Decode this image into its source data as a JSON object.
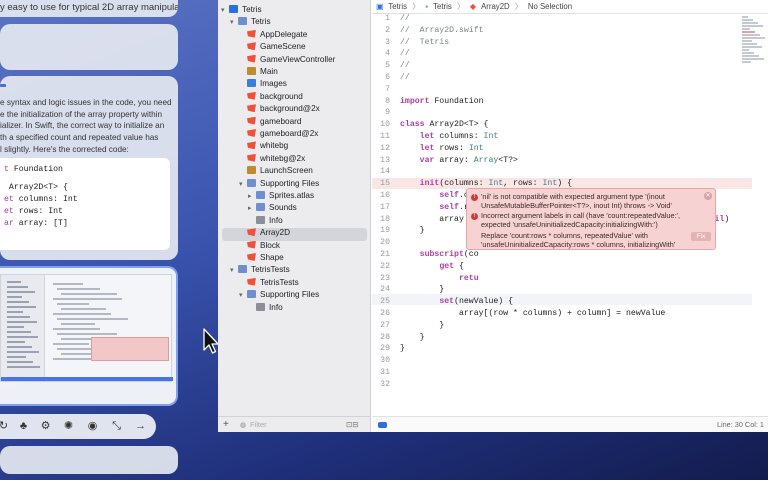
{
  "chat": {
    "top_text": "y easy to use for typical 2D array manipulations.",
    "answer_lines": [
      "e syntax and logic issues in the code, you need",
      "e the initialization of the array property within",
      "ializer. In Swift, the correct way to initialize an",
      "th a specified count and repeated value has",
      "l slightly. Here's the corrected code:"
    ],
    "code_lines": [
      {
        "kw": "t",
        "rest": " Foundation"
      },
      {
        "kw": "",
        "rest": " Array2D<T> {"
      },
      {
        "kw": "et",
        "rest": " columns: Int"
      },
      {
        "kw": "et",
        "rest": " rows: Int"
      },
      {
        "kw": "ar",
        "rest": " array: [T]"
      }
    ],
    "toolbar_icons": [
      "replay-icon",
      "users-icon",
      "gear-icon",
      "sparkle-icon",
      "stop-icon",
      "resize-icon",
      "send-arrow-icon"
    ]
  },
  "xcode": {
    "jumpbar": [
      "Tetris",
      "Tetris",
      "Array2D",
      "No Selection"
    ],
    "navigator": [
      {
        "label": "Tetris",
        "icon": "proj",
        "indent": 0,
        "chev": "▾"
      },
      {
        "label": "Tetris",
        "icon": "folder",
        "indent": 1,
        "chev": "▾"
      },
      {
        "label": "AppDelegate",
        "icon": "swift",
        "indent": 2,
        "chev": ""
      },
      {
        "label": "GameScene",
        "icon": "swift",
        "indent": 2,
        "chev": ""
      },
      {
        "label": "GameViewController",
        "icon": "swift",
        "indent": 2,
        "chev": ""
      },
      {
        "label": "Main",
        "icon": "story",
        "indent": 2,
        "chev": ""
      },
      {
        "label": "Images",
        "icon": "asset",
        "indent": 2,
        "chev": ""
      },
      {
        "label": "background",
        "icon": "swift",
        "indent": 2,
        "chev": ""
      },
      {
        "label": "background@2x",
        "icon": "swift",
        "indent": 2,
        "chev": ""
      },
      {
        "label": "gameboard",
        "icon": "swift",
        "indent": 2,
        "chev": ""
      },
      {
        "label": "gameboard@2x",
        "icon": "swift",
        "indent": 2,
        "chev": ""
      },
      {
        "label": "whitebg",
        "icon": "swift",
        "indent": 2,
        "chev": ""
      },
      {
        "label": "whitebg@2x",
        "icon": "swift",
        "indent": 2,
        "chev": ""
      },
      {
        "label": "LaunchScreen",
        "icon": "story",
        "indent": 2,
        "chev": ""
      },
      {
        "label": "Supporting Files",
        "icon": "folder",
        "indent": 2,
        "chev": "▾"
      },
      {
        "label": "Sprites.atlas",
        "icon": "folder",
        "indent": 3,
        "chev": "▸"
      },
      {
        "label": "Sounds",
        "icon": "folder",
        "indent": 3,
        "chev": "▸"
      },
      {
        "label": "Info",
        "icon": "plist",
        "indent": 3,
        "chev": ""
      },
      {
        "label": "Array2D",
        "icon": "swift",
        "indent": 2,
        "chev": ""
      },
      {
        "label": "Block",
        "icon": "swift",
        "indent": 2,
        "chev": ""
      },
      {
        "label": "Shape",
        "icon": "swift",
        "indent": 2,
        "chev": ""
      },
      {
        "label": "TetrisTests",
        "icon": "folder",
        "indent": 1,
        "chev": "▾"
      },
      {
        "label": "TetrisTests",
        "icon": "swift",
        "indent": 2,
        "chev": ""
      },
      {
        "label": "Supporting Files",
        "icon": "folder",
        "indent": 2,
        "chev": "▾"
      },
      {
        "label": "Info",
        "icon": "plist",
        "indent": 3,
        "chev": ""
      }
    ],
    "filter_placeholder": "Filter",
    "code": [
      {
        "n": "1",
        "html": "<span class='cm'>//</span>"
      },
      {
        "n": "2",
        "html": "<span class='cm'>//  Array2D.swift</span>"
      },
      {
        "n": "3",
        "html": "<span class='cm'>//  Tetris</span>"
      },
      {
        "n": "4",
        "html": "<span class='cm'>//</span>"
      },
      {
        "n": "5",
        "html": "<span class='cm'>//</span>"
      },
      {
        "n": "6",
        "html": "<span class='cm'>//</span>"
      },
      {
        "n": "7",
        "html": ""
      },
      {
        "n": "8",
        "html": "<span class='k2'>import</span> Foundation"
      },
      {
        "n": "9",
        "html": ""
      },
      {
        "n": "10",
        "html": "<span class='k2'>class</span> Array2D&lt;T&gt; {"
      },
      {
        "n": "11",
        "html": "    <span class='k2'>let</span> columns: <span class='t2'>Int</span>"
      },
      {
        "n": "12",
        "html": "    <span class='k2'>let</span> rows: <span class='t2'>Int</span>"
      },
      {
        "n": "13",
        "html": "    <span class='k2'>var</span> array: <span class='t2'>Array</span>&lt;T?&gt;"
      },
      {
        "n": "14",
        "html": ""
      },
      {
        "n": "15",
        "html": "    <span class='k2'>init</span>(columns: <span class='t2'>Int</span>, rows: <span class='t2'>Int</span>) {"
      },
      {
        "n": "16",
        "html": "        <span class='k2'>self</span>.columns = columns"
      },
      {
        "n": "17",
        "html": "        <span class='k2'>self</span>.rows = rows"
      },
      {
        "n": "18",
        "html": "        array = <span class='t2'>Array</span>&lt;T?&gt;(count:rows * columns, repeatedValue: <span class='k2'>nil</span>)"
      },
      {
        "n": "19",
        "html": "    }"
      },
      {
        "n": "20",
        "html": ""
      },
      {
        "n": "21",
        "html": "    <span class='k2'>subscript</span>(co"
      },
      {
        "n": "22",
        "html": "        <span class='k2'>get</span> {"
      },
      {
        "n": "23",
        "html": "            <span class='k2'>retu</span>"
      },
      {
        "n": "24",
        "html": "        }"
      },
      {
        "n": "25",
        "html": "        <span class='k2'>set</span>(newValue) {"
      },
      {
        "n": "26",
        "html": "            array[(row * columns) + column] = newValue"
      },
      {
        "n": "27",
        "html": "        }"
      },
      {
        "n": "28",
        "html": "    }"
      },
      {
        "n": "29",
        "html": "}"
      },
      {
        "n": "30",
        "html": ""
      },
      {
        "n": "31",
        "html": ""
      },
      {
        "n": "32",
        "html": ""
      }
    ],
    "errors": [
      "'nil' is not compatible with expected argument type '(inout UnsafeMutableBufferPointer<T?>, inout Int) throws -> Void'",
      "Incorrect argument labels in call (have 'count:repeatedValue:', expected 'unsafeUninitializedCapacity:initializingWith:')",
      "Replace 'count:rows * columns, repeatedValue' with 'unsafeUninitializedCapacity:rows * columns, initializingWith'"
    ],
    "fix_label": "Fix",
    "status_position": "Line: 30  Col: 1"
  }
}
